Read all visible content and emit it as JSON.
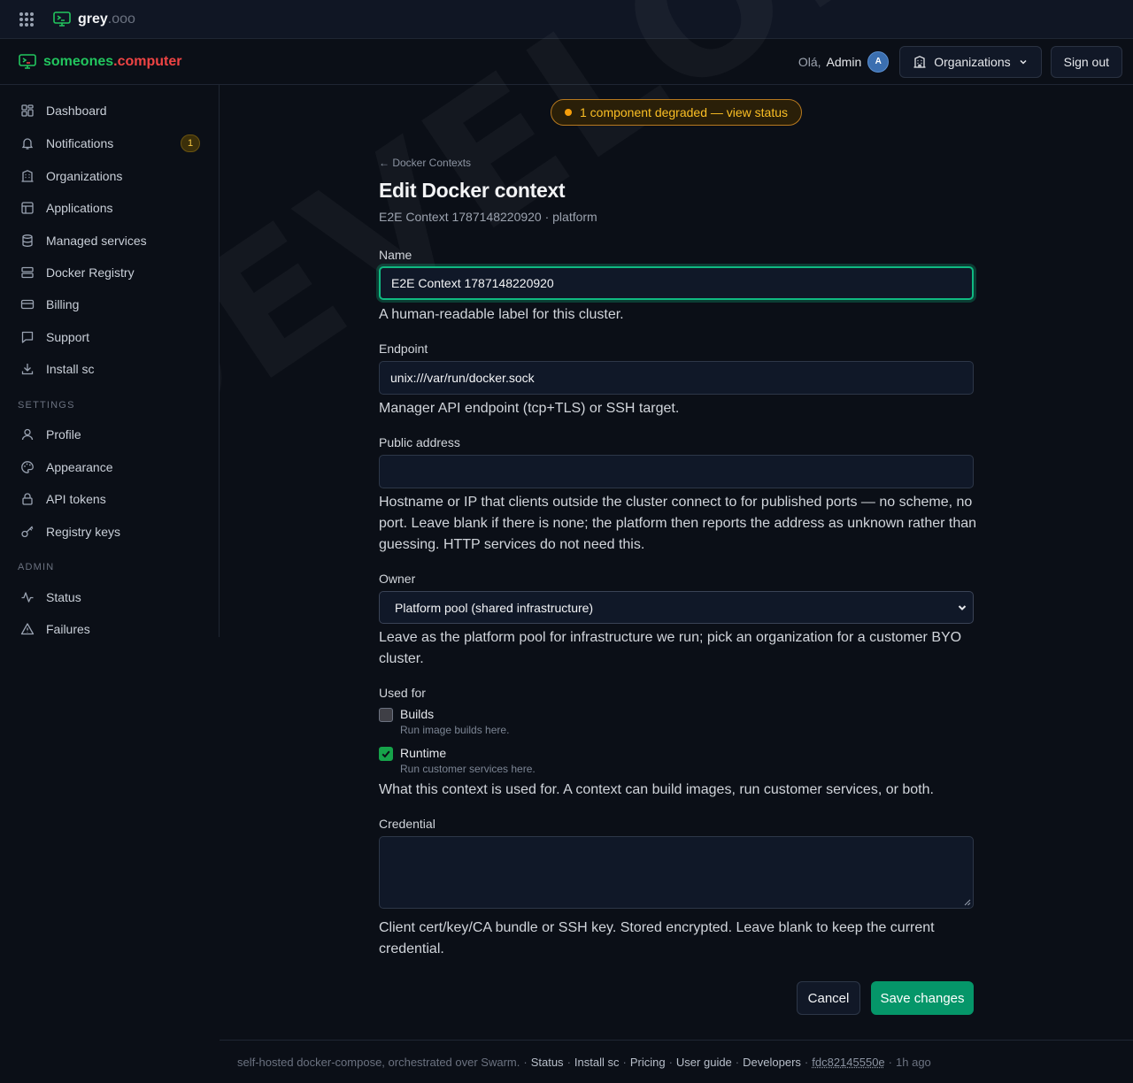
{
  "topbar": {
    "app_name": "grey",
    "app_tld": ".ooo"
  },
  "header": {
    "brand_part1": "someones",
    "brand_part2": ".computer",
    "greeting": "Olá,",
    "username": "Admin",
    "avatar_initial": "A",
    "orgs_label": "Organizations",
    "signout_label": "Sign out"
  },
  "sidebar": {
    "items": [
      {
        "label": "Dashboard",
        "icon": "dashboard-icon"
      },
      {
        "label": "Notifications",
        "icon": "bell-icon",
        "badge": "1"
      },
      {
        "label": "Organizations",
        "icon": "building-icon"
      },
      {
        "label": "Applications",
        "icon": "layout-icon"
      },
      {
        "label": "Managed services",
        "icon": "database-icon"
      },
      {
        "label": "Docker Registry",
        "icon": "server-icon"
      },
      {
        "label": "Billing",
        "icon": "credit-card-icon"
      },
      {
        "label": "Support",
        "icon": "chat-icon"
      },
      {
        "label": "Install sc",
        "icon": "download-icon"
      }
    ],
    "settings_label": "SETTINGS",
    "settings_items": [
      {
        "label": "Profile",
        "icon": "user-icon"
      },
      {
        "label": "Appearance",
        "icon": "palette-icon"
      },
      {
        "label": "API tokens",
        "icon": "lock-icon"
      },
      {
        "label": "Registry keys",
        "icon": "key-icon"
      }
    ],
    "admin_label": "ADMIN",
    "admin_items": [
      {
        "label": "Status",
        "icon": "activity-icon"
      },
      {
        "label": "Failures",
        "icon": "warning-icon"
      }
    ]
  },
  "watermark": "DEVELOPMENT",
  "status_banner": "1 component degraded — view status",
  "form": {
    "back_link": "← Docker Contexts",
    "title": "Edit Docker context",
    "subtitle": "E2E Context 1787148220920 · platform",
    "name_label": "Name",
    "name_value": "E2E Context 1787148220920",
    "name_help": "A human-readable label for this cluster.",
    "endpoint_label": "Endpoint",
    "endpoint_value": "unix:///var/run/docker.sock",
    "endpoint_help": "Manager API endpoint (tcp+TLS) or SSH target.",
    "public_address_label": "Public address",
    "public_address_value": "",
    "public_address_help": "Hostname or IP that clients outside the cluster connect to for published ports — no scheme, no port. Leave blank if there is none; the platform then reports the address as unknown rather than guessing. HTTP services do not need this.",
    "owner_label": "Owner",
    "owner_value": "Platform pool (shared infrastructure)",
    "owner_help": "Leave as the platform pool for infrastructure we run; pick an organization for a customer BYO cluster.",
    "used_for_label": "Used for",
    "builds_label": "Builds",
    "builds_sub": "Run image builds here.",
    "builds_checked": false,
    "runtime_label": "Runtime",
    "runtime_sub": "Run customer services here.",
    "runtime_checked": true,
    "used_for_help": "What this context is used for. A context can build images, run customer services, or both.",
    "credential_label": "Credential",
    "credential_value": "",
    "credential_help": "Client cert/key/CA bundle or SSH key. Stored encrypted. Leave blank to keep the current credential.",
    "cancel_label": "Cancel",
    "save_label": "Save changes"
  },
  "footer": {
    "tagline": "self-hosted docker-compose, orchestrated over Swarm.",
    "links": [
      "Status",
      "Install sc",
      "Pricing",
      "User guide",
      "Developers"
    ],
    "commit": "fdc82145550e",
    "age": "1h ago"
  },
  "colors": {
    "accent_green": "#10b981",
    "save_button": "#059669",
    "warning": "#f59e0b",
    "brand_red": "#ef4444"
  }
}
